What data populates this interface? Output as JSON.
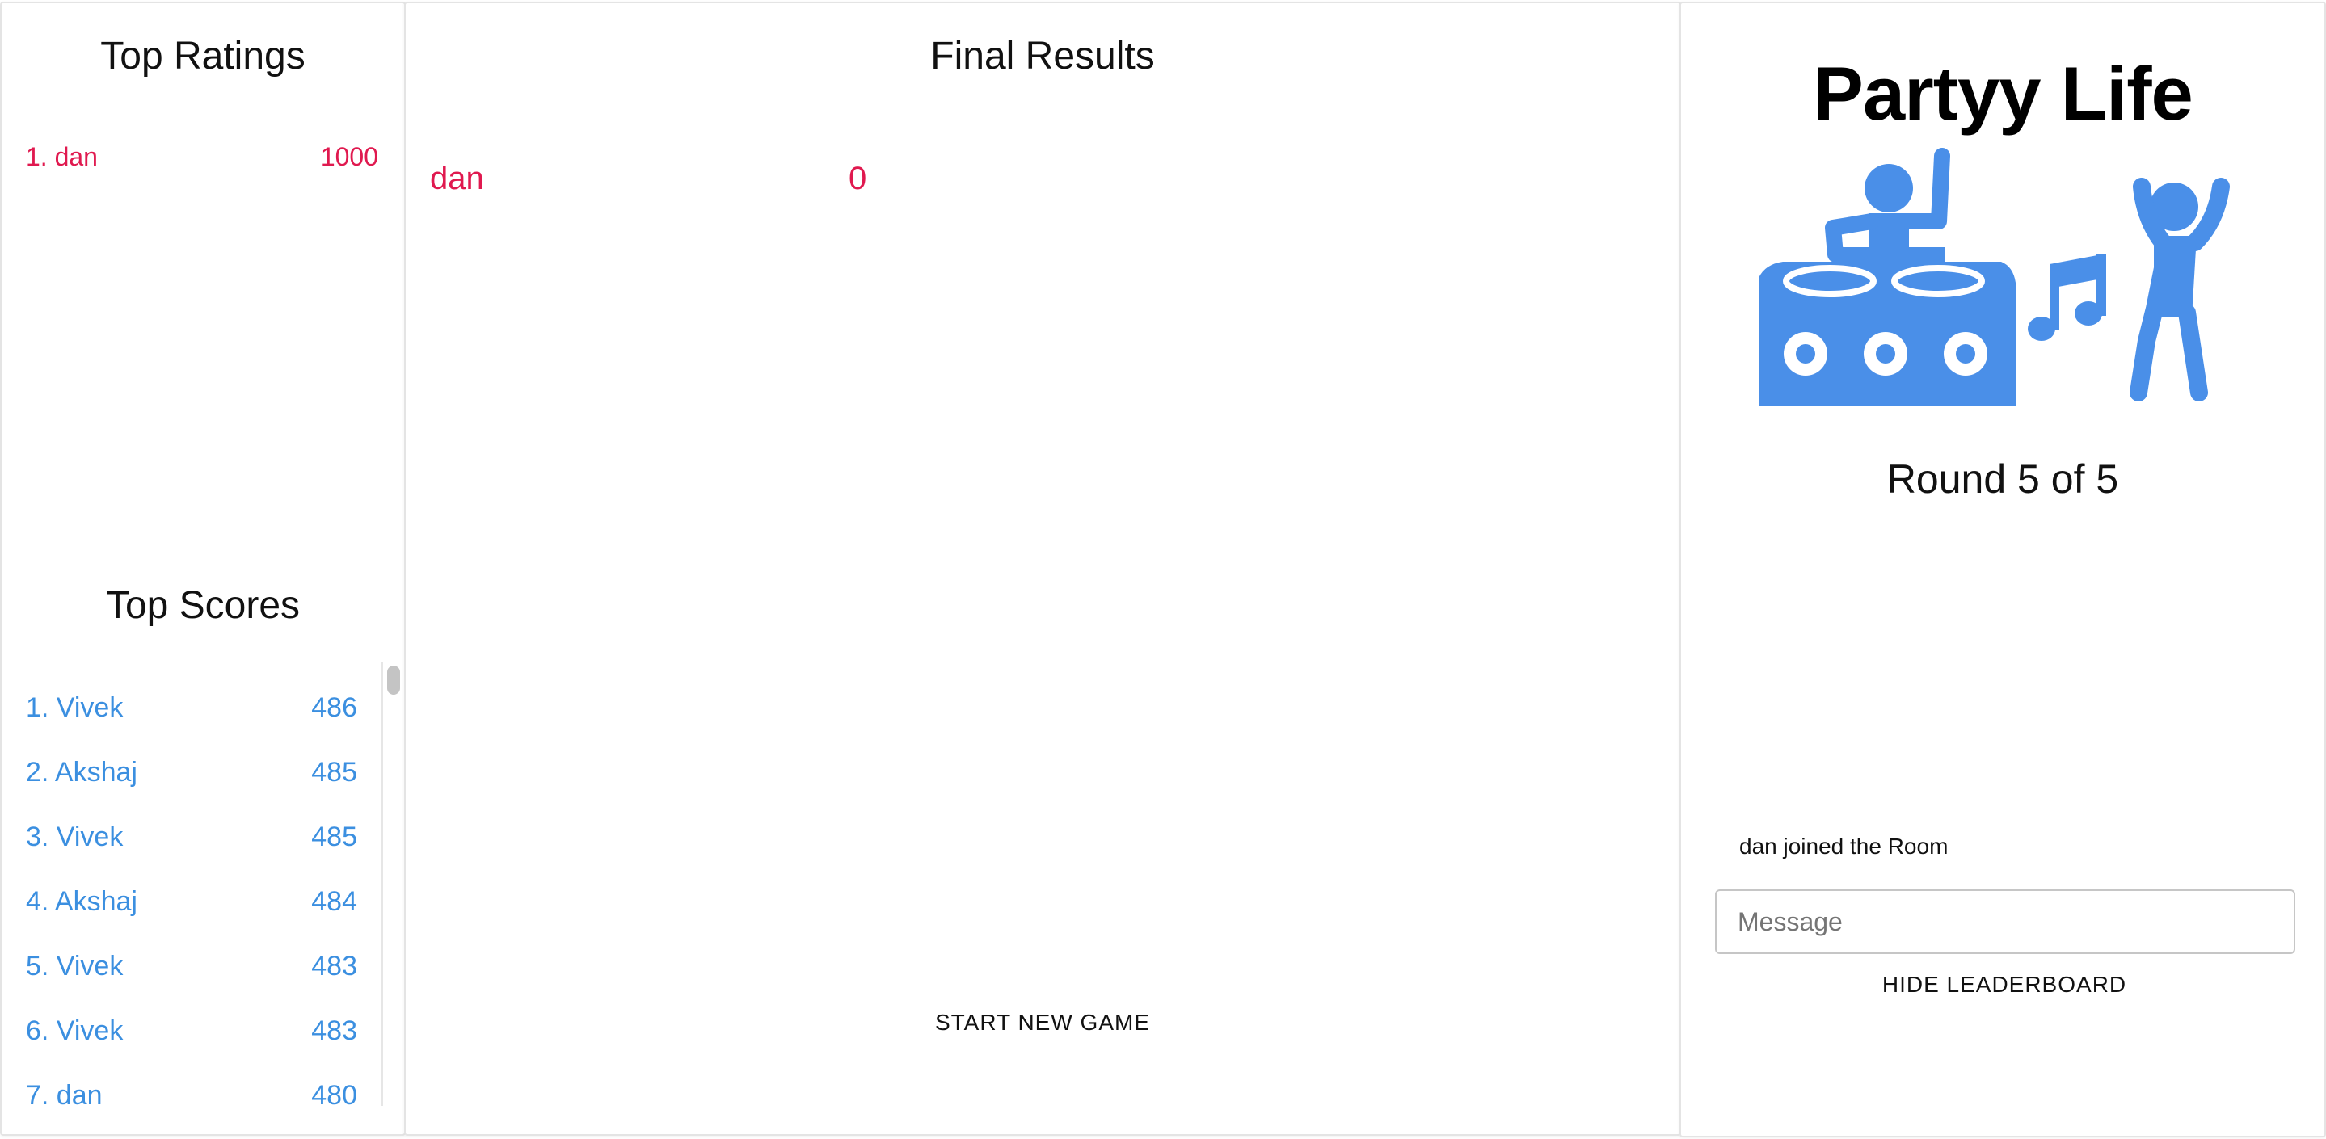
{
  "left": {
    "ratings_title": "Top Ratings",
    "ratings": [
      {
        "name": "1. dan",
        "value": "1000"
      }
    ],
    "scores_title": "Top Scores",
    "scores": [
      {
        "name": "1. Vivek",
        "value": "486"
      },
      {
        "name": "2. Akshaj",
        "value": "485"
      },
      {
        "name": "3. Vivek",
        "value": "485"
      },
      {
        "name": "4. Akshaj",
        "value": "484"
      },
      {
        "name": "5. Vivek",
        "value": "483"
      },
      {
        "name": "6. Vivek",
        "value": "483"
      },
      {
        "name": "7. dan",
        "value": "480"
      }
    ]
  },
  "middle": {
    "title": "Final Results",
    "results": [
      {
        "name": "dan",
        "score": "0"
      }
    ],
    "start_label": "START NEW GAME"
  },
  "right": {
    "app_title": "Partyy Life",
    "illustration_icons": [
      "dj-booth-icon",
      "music-note-icon",
      "dancer-icon"
    ],
    "round_text": "Round 5 of 5",
    "chat_messages": [
      "dan joined the Room"
    ],
    "message_placeholder": "Message",
    "hide_label": "HIDE LEADERBOARD"
  },
  "colors": {
    "ratings_accent": "#e0194f",
    "scores_accent": "#3b8fe0",
    "illustration": "#4a8fe8"
  }
}
